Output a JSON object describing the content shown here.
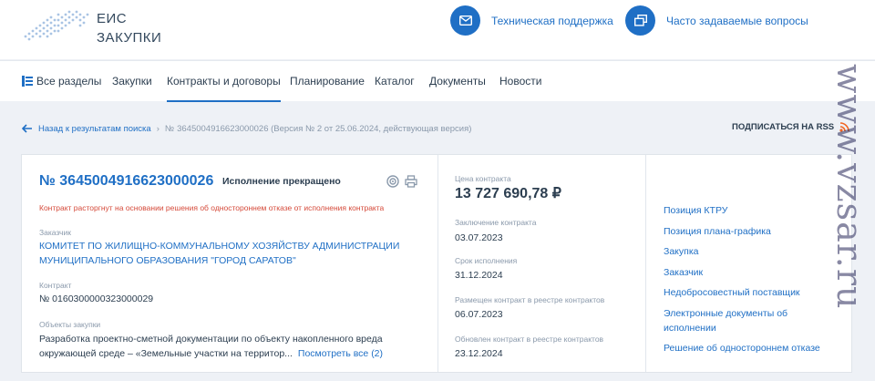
{
  "header": {
    "logo_line1": "ЕИС",
    "logo_line2": "ЗАКУПКИ",
    "support_label": "Техническая поддержка",
    "faq_label": "Часто задаваемые вопросы"
  },
  "nav": {
    "items": [
      "Все разделы",
      "Закупки",
      "Контракты и договоры",
      "Планирование",
      "Каталог",
      "Документы",
      "Новости"
    ],
    "active": "Контракты и договоры"
  },
  "breadcrumb": {
    "back_label": "Назад к результатам поиска",
    "separator": "№",
    "current": "3645004916623000026 (Версия № 2 от 25.06.2024, действующая версия)"
  },
  "rss_label": "ПОДПИСАТЬСЯ НА RSS",
  "contract": {
    "reg_number": "№ 3645004916623000026",
    "status": "Исполнение прекращено",
    "warning": "Контракт расторгнут на основании решения об одностороннем отказе от исполнения контракта",
    "customer_label": "Заказчик",
    "customer_name": "КОМИТЕТ ПО ЖИЛИЩНО-КОММУНАЛЬНОМУ ХОЗЯЙСТВУ АДМИНИСТРАЦИИ МУНИЦИПАЛЬНОГО ОБРАЗОВАНИЯ \"ГОРОД САРАТОВ\"",
    "contract_label": "Контракт",
    "contract_number": "№ 0160300000323000029",
    "objects_label": "Объекты закупки",
    "objects_text": "Разработка проектно-сметной документации по объекту накопленного вреда окружающей среде – «Земельные участки на территор...",
    "see_all_label": "Посмотреть все (2)"
  },
  "details": {
    "price_label": "Цена контракта",
    "price_value": "13 727 690,78 ₽",
    "conclusion_label": "Заключение контракта",
    "conclusion_date": "03.07.2023",
    "term_label": "Срок исполнения",
    "term_date": "31.12.2024",
    "posted_label": "Размещен контракт в реестре контрактов",
    "posted_date": "06.07.2023",
    "updated_label": "Обновлен контракт в реестре контрактов",
    "updated_date": "23.12.2024"
  },
  "links": [
    "Позиция КТРУ",
    "Позиция плана-графика",
    "Закупка",
    "Заказчик",
    "Недобросовестный поставщик",
    "Электронные документы об исполнении",
    "Решение об одностороннем отказе"
  ],
  "watermark": "www.vzsar.ru",
  "colors": {
    "accent": "#1f6fc5",
    "warning": "#d54a3a",
    "rss": "#f26522",
    "muted": "#8a99ab"
  }
}
